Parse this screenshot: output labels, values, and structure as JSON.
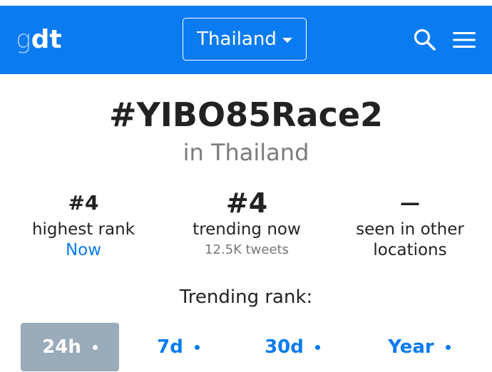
{
  "header": {
    "logo_g": "g",
    "logo_dt": "dt",
    "country": "Thailand",
    "search_icon": "search-icon",
    "menu_icon": "hamburger-menu-icon"
  },
  "hashtag": "#YIBO85Race2",
  "location_text": "in Thailand",
  "stats": {
    "highest_rank": {
      "value": "#4",
      "label": "highest rank",
      "sub": "Now"
    },
    "trending_now": {
      "value": "#4",
      "label": "trending now",
      "sub": "12.5K tweets"
    },
    "other_locations": {
      "value": "—",
      "label_line1": "seen in other",
      "label_line2": "locations"
    }
  },
  "trending_rank_label": "Trending rank:",
  "tabs": [
    {
      "label": "24h",
      "active": true
    },
    {
      "label": "7d",
      "active": false
    },
    {
      "label": "30d",
      "active": false
    },
    {
      "label": "Year",
      "active": false
    }
  ],
  "colors": {
    "brand": "#0a7bf1",
    "active_tab": "#9aabba",
    "muted_text": "#7b7b7b"
  }
}
